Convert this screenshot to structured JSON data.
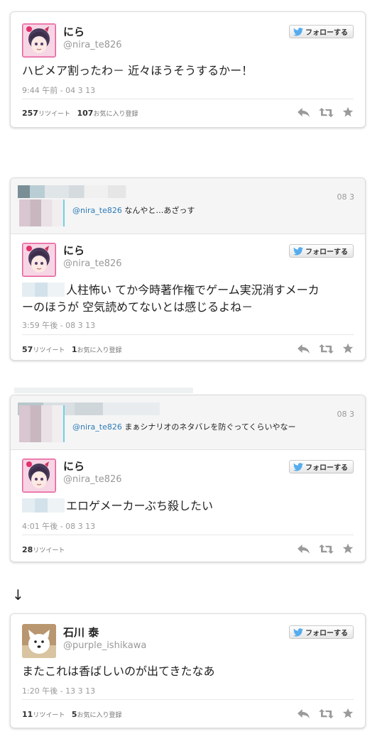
{
  "tweet1": {
    "name": "にら",
    "handle": "@nira_te826",
    "follow_label": "フォローする",
    "text": "ハピメア割ったわ－ 近々ほうそうするかー！",
    "time": "9:44 午前 - 04 3 13",
    "retweets": "257",
    "retweets_label": "リツイート",
    "favorites": "107",
    "favorites_label": "お気に入り登録"
  },
  "tweet2": {
    "reply_mention": "@nira_te826",
    "reply_text": " なんやと…あざっす",
    "reply_date": "08 3",
    "name": "にら",
    "handle": "@nira_te826",
    "follow_label": "フォローする",
    "text_line1": "人柱怖い てか今時著作権でゲーム実況消すメーカ",
    "text_line2": "ーのほうが 空気読めてないとは感じるよね－",
    "time": "3:59 午後 - 08 3 13",
    "retweets": "57",
    "retweets_label": "リツイート",
    "favorites": "1",
    "favorites_label": "お気に入り登録"
  },
  "tweet3": {
    "reply_mention": "@nira_te826",
    "reply_text": " まぁシナリオのネタバレを防ぐってくらいやなー",
    "reply_date": "08 3",
    "name": "にら",
    "handle": "@nira_te826",
    "follow_label": "フォローする",
    "text": "エロゲメーカーぶち殺したい",
    "time": "4:01 午後 - 08 3 13",
    "retweets": "28",
    "retweets_label": "リツイート"
  },
  "arrow": "↓",
  "tweet4": {
    "name": "石川 泰",
    "handle": "@purple_ishikawa",
    "follow_label": "フォローする",
    "text": "またこれは香ばしいのが出てきたなあ",
    "time": "1:20 午後 - 13 3 13",
    "retweets": "11",
    "retweets_label": "リツイート",
    "favorites": "5",
    "favorites_label": "お気に入り登録"
  },
  "colors": {
    "link": "#2b7bb9",
    "twitter_bird": "#55acee",
    "muted": "#999999"
  },
  "icons": [
    "twitter-bird-icon",
    "reply-icon",
    "retweet-icon",
    "favorite-star-icon"
  ]
}
